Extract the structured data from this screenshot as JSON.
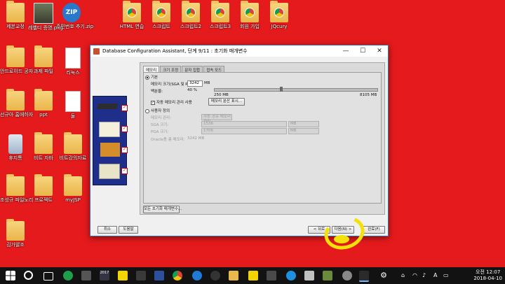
{
  "desktop": {
    "icons": [
      {
        "label": "제본교정",
        "icon": "folder-icon"
      },
      {
        "label": "레벨디 증명.png",
        "icon": "photo-icon"
      },
      {
        "label": "주민번호 추기.zip",
        "icon": "zip-icon",
        "badge": "ZIP"
      },
      {
        "label": "HTML 연습",
        "icon": "chrome-folder-icon"
      },
      {
        "label": "스크립트",
        "icon": "chrome-folder-icon"
      },
      {
        "label": "스크립트2",
        "icon": "chrome-folder-icon"
      },
      {
        "label": "스크립트3",
        "icon": "chrome-folder-icon"
      },
      {
        "label": "회원 가입",
        "icon": "chrome-folder-icon"
      },
      {
        "label": "JQcury",
        "icon": "chrome-folder-icon"
      },
      {
        "label": "안드로이드 공자",
        "icon": "folder-icon"
      },
      {
        "label": "과제 파일",
        "icon": "folder-icon"
      },
      {
        "label": "리눅스",
        "icon": "document-icon"
      },
      {
        "label": "선규아 홈에하자",
        "icon": "folder-icon"
      },
      {
        "label": "ppt",
        "icon": "folder-icon"
      },
      {
        "label": "둘",
        "icon": "document-icon"
      },
      {
        "label": "휴지통",
        "icon": "recycle-bin-icon"
      },
      {
        "label": "비트 자바",
        "icon": "folder-icon"
      },
      {
        "label": "비트강의자료",
        "icon": "folder-icon"
      },
      {
        "label": "조성규 파일노리",
        "icon": "folder-icon"
      },
      {
        "label": "프로젝트",
        "icon": "folder-icon"
      },
      {
        "label": "myJSP",
        "icon": "folder-icon"
      },
      {
        "label": "김가발조",
        "icon": "folder-icon"
      }
    ]
  },
  "window": {
    "title": "Database Configuration Assistant, 단계 9/11 : 초기화 매개변수",
    "minimize": "—",
    "maximize": "☐",
    "close": "✕",
    "tabs": [
      "메모리",
      "크기 조정",
      "문자 집합",
      "접속 모드"
    ],
    "typical_label": "기본",
    "memory_size_label": "메모리 크기(SGA 및 PGA):",
    "memory_size_value": "3242",
    "memory_unit": "MB",
    "percent_label": "백분율:",
    "percent_value": "40 %",
    "slider_min": "250 MB",
    "slider_max": "8105 MB",
    "slider_fraction": 0.4,
    "auto_memory_label": "자동 메모리 관리 사용",
    "show_memory_dist_button": "메모리 분산 표시...",
    "custom_label": "사용자 정의",
    "memory_mgmt_label": "메모리 관리:",
    "memory_mgmt_value": "자동 공유 메모리 관리",
    "sga_label": "SGA 크기:",
    "sga_value": "1536",
    "sga_unit": "MB",
    "pga_label": "PGA 크기:",
    "pga_value": "1706",
    "pga_unit": "MB",
    "total_label": "Oracle용 총 메모리:",
    "total_value": "3242 MB",
    "all_params_button": "모든 초기화 매개변수...",
    "cancel_button": "취소",
    "help_button": "도움말",
    "back_button": "< 뒤로",
    "next_button": "다음(N) >",
    "finish_button": "완료(F)"
  },
  "taskbar": {
    "time": "오전 12:07",
    "date": "2018-04-10",
    "ime": "A",
    "badge_2017": "2017"
  }
}
